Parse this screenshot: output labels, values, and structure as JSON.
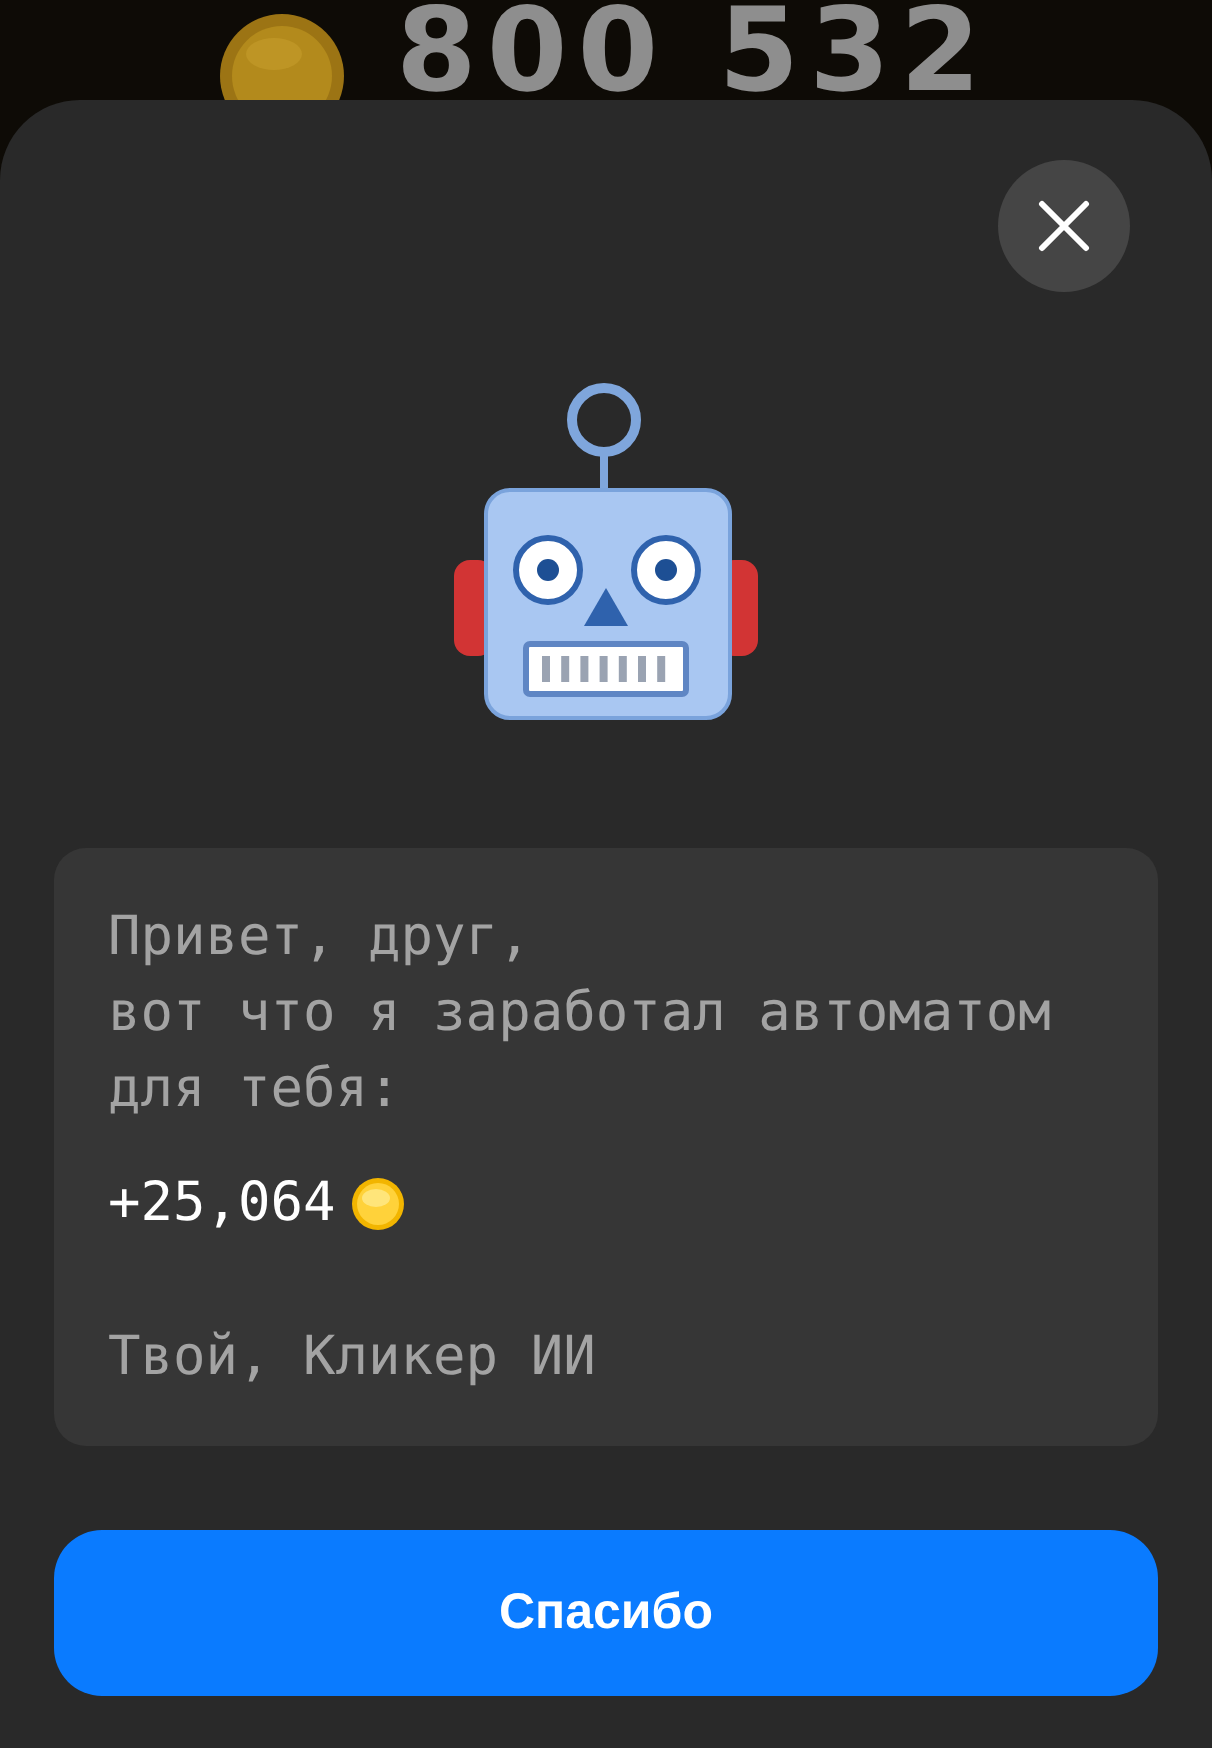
{
  "background": {
    "balance": "800 532"
  },
  "message": {
    "text": "Привет, друг,\nвот что я заработал автоматом\nдля тебя:",
    "amount": "+25,064",
    "signature": "Твой, Кликер ИИ"
  },
  "button": {
    "label": "Спасибо"
  }
}
